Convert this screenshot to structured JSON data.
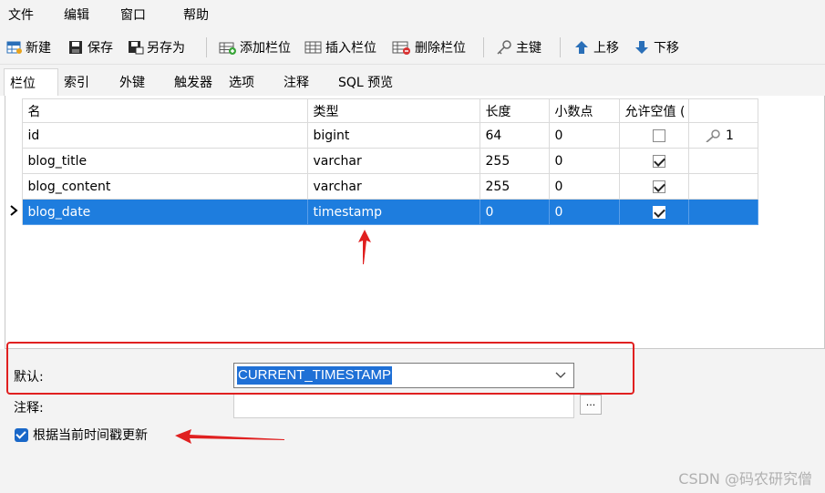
{
  "menu": [
    "文件",
    "编辑",
    "窗口",
    "帮助"
  ],
  "toolbar": {
    "new": "新建",
    "save": "保存",
    "save_as": "另存为",
    "add_field": "添加栏位",
    "insert_field": "插入栏位",
    "delete_field": "删除栏位",
    "primary_key": "主键",
    "move_up": "上移",
    "move_down": "下移"
  },
  "tabs": [
    "栏位",
    "索引",
    "外键",
    "触发器",
    "选项",
    "注释",
    "SQL 预览"
  ],
  "grid": {
    "headers": [
      "名",
      "类型",
      "长度",
      "小数点",
      "允许空值 ("
    ],
    "rows": [
      {
        "name": "id",
        "type": "bigint",
        "length": "64",
        "decimals": "0",
        "not_null": false,
        "key": "1"
      },
      {
        "name": "blog_title",
        "type": "varchar",
        "length": "255",
        "decimals": "0",
        "not_null": true,
        "key": ""
      },
      {
        "name": "blog_content",
        "type": "varchar",
        "length": "255",
        "decimals": "0",
        "not_null": true,
        "key": ""
      },
      {
        "name": "blog_date",
        "type": "timestamp",
        "length": "0",
        "decimals": "0",
        "not_null": true,
        "key": ""
      }
    ],
    "selected_row": 3
  },
  "props": {
    "default_label": "默认:",
    "default_value": "CURRENT_TIMESTAMP",
    "comment_label": "注释:",
    "comment_value": "",
    "ellipsis": "...",
    "on_update_label": "根据当前时间戳更新",
    "on_update_checked": true
  },
  "watermark": "CSDN @码农研究僧",
  "colors": {
    "selection": "#1e7dde",
    "annotation_red": "#e02020",
    "checkbox_blue": "#1967c8"
  }
}
